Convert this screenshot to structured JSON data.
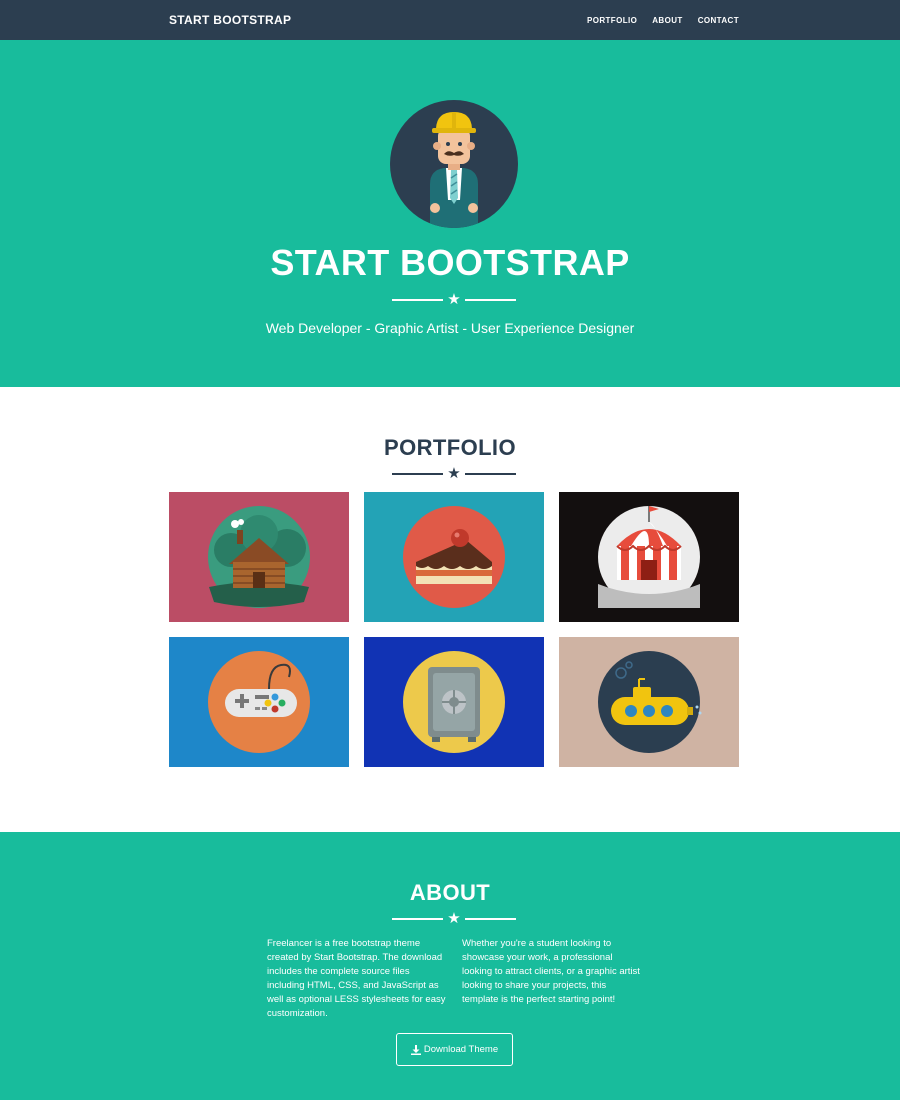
{
  "nav": {
    "brand": "START BOOTSTRAP",
    "links": [
      "PORTFOLIO",
      "ABOUT",
      "CONTACT"
    ]
  },
  "hero": {
    "title": "START BOOTSTRAP",
    "tagline": "Web Developer - Graphic Artist - User Experience Designer",
    "divider_icon": "star-icon"
  },
  "portfolio": {
    "heading": "PORTFOLIO",
    "items": [
      {
        "icon": "cabin-icon",
        "bg": "#bb4d65",
        "circle": "#3a9c7f"
      },
      {
        "icon": "cake-icon",
        "bg": "#23a3b6",
        "circle": "#e05a48"
      },
      {
        "icon": "circus-tent-icon",
        "bg": "#130f0f",
        "circle": "#ececec"
      },
      {
        "icon": "game-controller-icon",
        "bg": "#1e87c9",
        "circle": "#e58145"
      },
      {
        "icon": "safe-icon",
        "bg": "#1133b4",
        "circle": "#edc94b"
      },
      {
        "icon": "submarine-icon",
        "bg": "#cfb3a3",
        "circle": "#2b3e50"
      }
    ]
  },
  "about": {
    "heading": "ABOUT",
    "paragraphs": [
      "Freelancer is a free bootstrap theme created by Start Bootstrap. The download includes the complete source files including HTML, CSS, and JavaScript as well as optional LESS stylesheets for easy customization.",
      "Whether you're a student looking to showcase your work, a professional looking to attract clients, or a graphic artist looking to share your projects, this template is the perfect starting point!"
    ],
    "button_label": "Download Theme",
    "button_icon": "download-icon"
  },
  "colors": {
    "primary": "#18bc9c",
    "dark": "#2c3e50",
    "white": "#ffffff"
  }
}
